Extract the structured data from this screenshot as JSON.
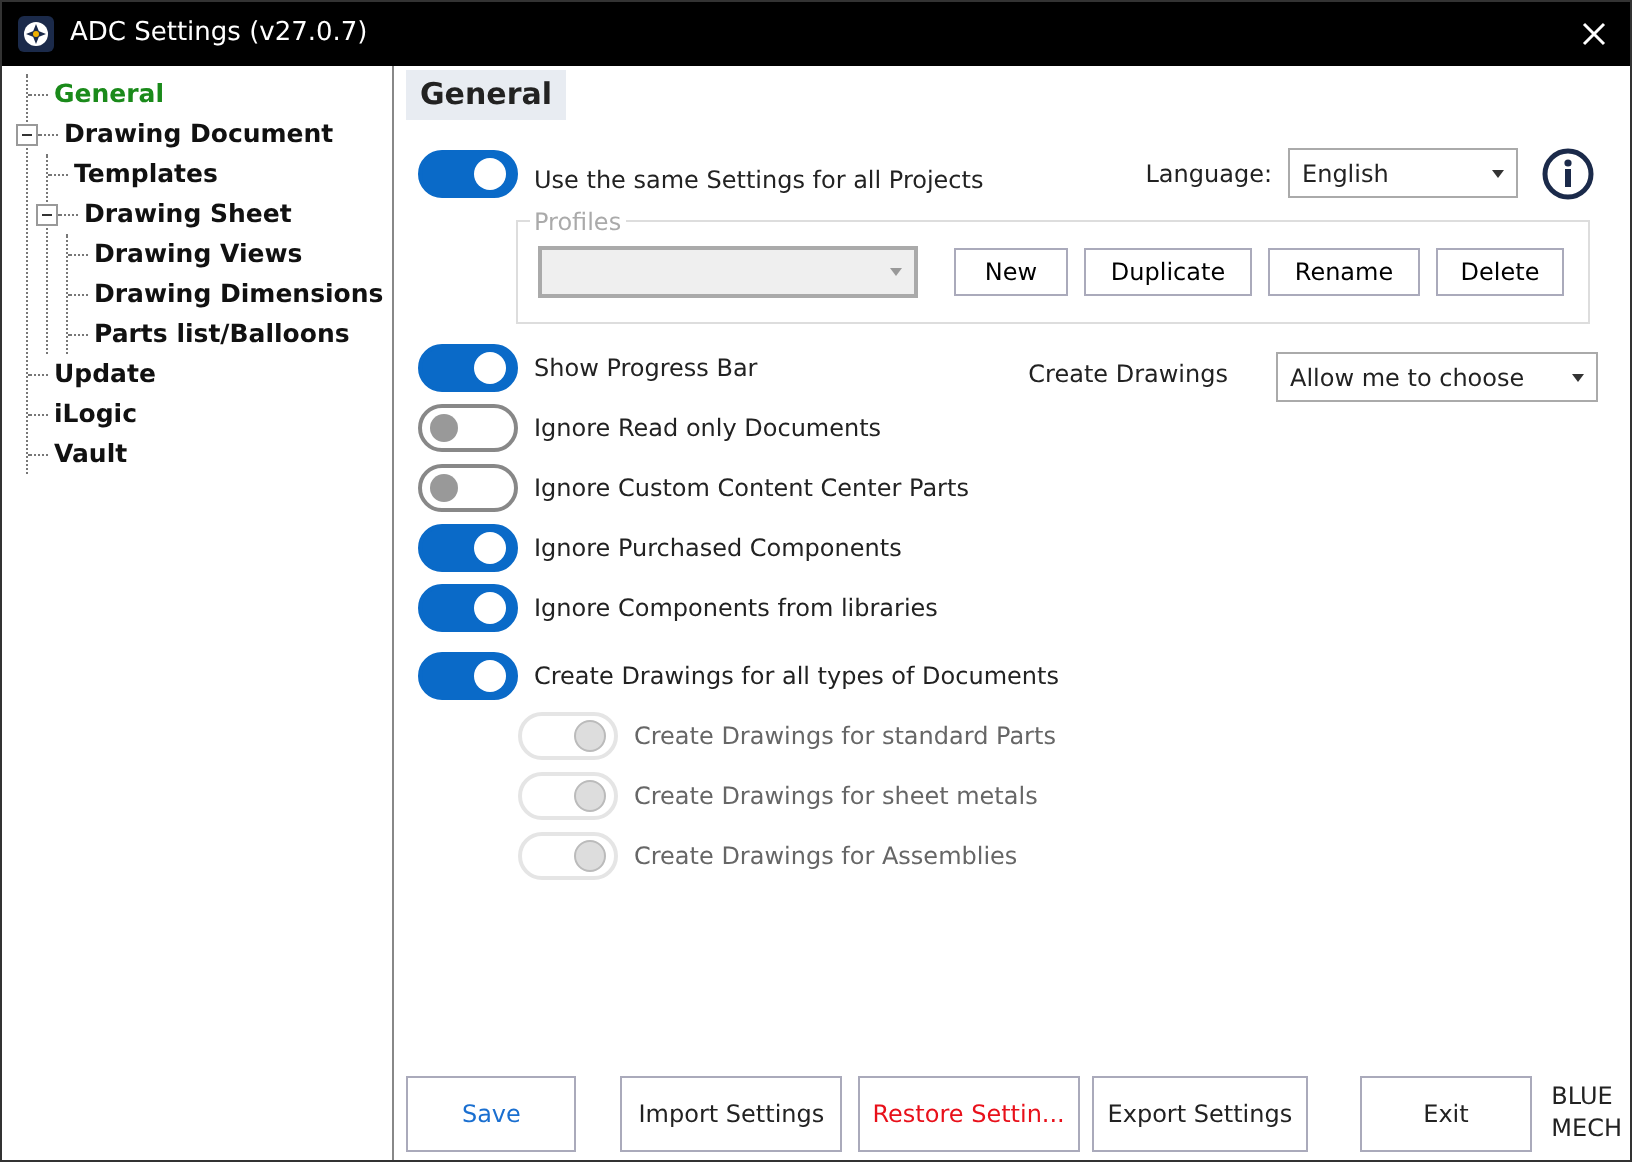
{
  "window": {
    "title": "ADC Settings (v27.0.7)"
  },
  "tree": [
    {
      "label": "General",
      "selected": true
    },
    {
      "label": "Drawing Document",
      "selected": false,
      "expanded": true,
      "children": [
        {
          "label": "Templates",
          "selected": false
        },
        {
          "label": "Drawing Sheet",
          "selected": false,
          "expanded": true,
          "children": [
            {
              "label": "Drawing Views",
              "selected": false
            },
            {
              "label": "Drawing Dimensions",
              "selected": false
            },
            {
              "label": "Parts list/Balloons",
              "selected": false
            }
          ]
        }
      ]
    },
    {
      "label": "Update",
      "selected": false
    },
    {
      "label": "iLogic",
      "selected": false
    },
    {
      "label": "Vault",
      "selected": false
    }
  ],
  "page_title": "General",
  "same_settings": {
    "label": "Use the same Settings for all Projects",
    "on": true,
    "disabled": false
  },
  "language": {
    "label": "Language:",
    "value": "English"
  },
  "profiles": {
    "title": "Profiles",
    "buttons": [
      "New",
      "Duplicate",
      "Rename",
      "Delete"
    ]
  },
  "create_drawings": {
    "label": "Create Drawings",
    "value": "Allow me to choose"
  },
  "options": [
    {
      "label": "Show Progress Bar",
      "on": true,
      "disabled": false,
      "indent": false
    },
    {
      "label": "Ignore Read only Documents",
      "on": false,
      "disabled": false,
      "indent": false
    },
    {
      "label": "Ignore Custom Content Center Parts",
      "on": false,
      "disabled": false,
      "indent": false
    },
    {
      "label": "Ignore Purchased Components",
      "on": true,
      "disabled": false,
      "indent": false
    },
    {
      "label": "Ignore Components from libraries",
      "on": true,
      "disabled": false,
      "indent": false
    },
    {
      "label": "Create Drawings for all types of Documents",
      "on": true,
      "disabled": false,
      "indent": false
    },
    {
      "label": "Create Drawings for standard Parts",
      "on": true,
      "disabled": true,
      "indent": true
    },
    {
      "label": "Create Drawings for sheet metals",
      "on": true,
      "disabled": true,
      "indent": true
    },
    {
      "label": "Create Drawings for Assemblies",
      "on": true,
      "disabled": true,
      "indent": true
    }
  ],
  "footer_buttons": [
    {
      "label": "Save",
      "kind": "primary"
    },
    {
      "label": "Import Settings",
      "kind": "normal"
    },
    {
      "label": "Restore Settin...",
      "kind": "danger"
    },
    {
      "label": "Export Settings",
      "kind": "normal"
    },
    {
      "label": "Exit",
      "kind": "normal"
    }
  ],
  "brand": [
    "BLUE",
    "MECH"
  ]
}
